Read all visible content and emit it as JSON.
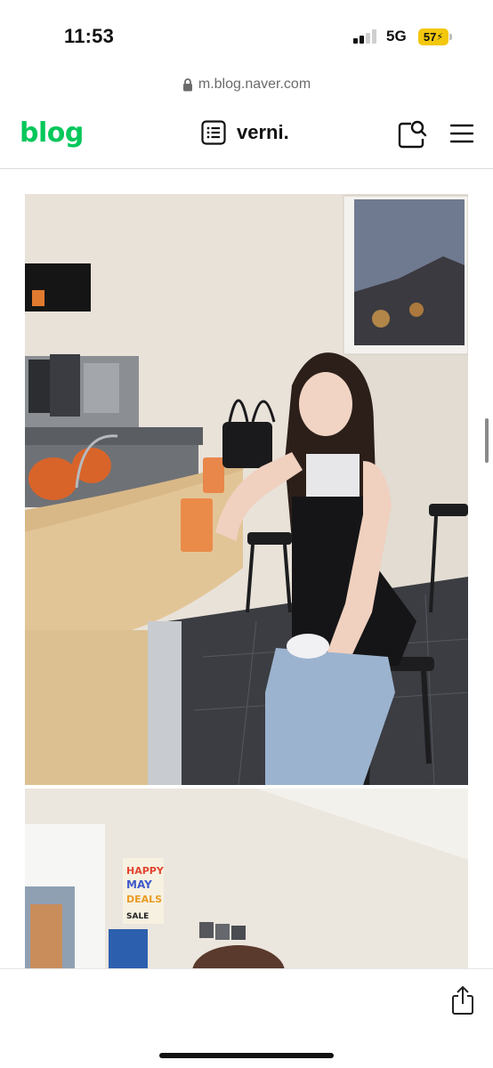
{
  "status": {
    "time": "11:53",
    "network": "5G",
    "battery": "57"
  },
  "browser": {
    "url": "m.blog.naver.com"
  },
  "header": {
    "logo": "blog",
    "title": "verni."
  },
  "icons": {
    "lock": "lock-icon",
    "list": "list-icon",
    "search": "search-icon",
    "menu": "hamburger-menu-icon",
    "share": "share-icon",
    "charging": "bolt-icon"
  },
  "colors": {
    "brand": "#03c75a",
    "battery": "#f2c70c"
  },
  "photo2": {
    "poster_text": "HAPPY MAY DEALS SALE"
  }
}
